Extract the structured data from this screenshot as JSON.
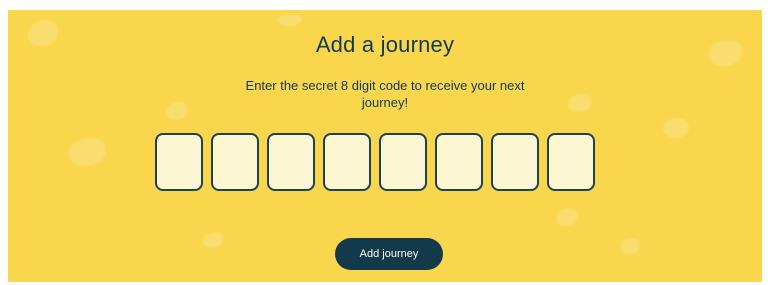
{
  "colors": {
    "background": "#f9d64b",
    "text": "#123a4a",
    "input_fill": "#fdf6d2",
    "input_border": "#1d4250",
    "button": "#123a4a",
    "button_text": "#ffffff"
  },
  "title": "Add a journey",
  "subtitle": "Enter the secret 8 digit code to receive your next journey!",
  "code_inputs": [
    "",
    "",
    "",
    "",
    "",
    "",
    "",
    ""
  ],
  "submit_label": "Add journey"
}
